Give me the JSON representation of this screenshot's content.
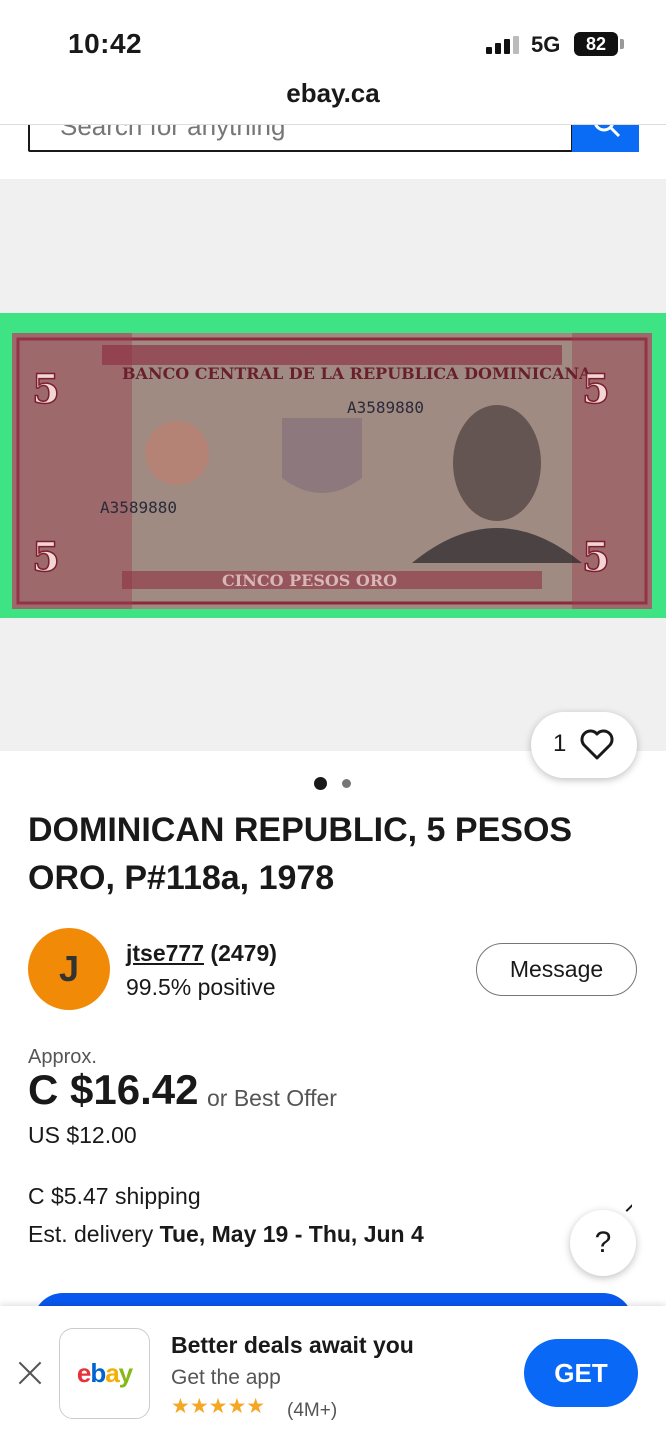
{
  "status_bar": {
    "time": "10:42",
    "network": "5G",
    "battery": "82"
  },
  "browser": {
    "url": "ebay.ca"
  },
  "search": {
    "placeholder": "Search for anything"
  },
  "gallery": {
    "image_alt": "Dominican Republic 5 Pesos Oro banknote",
    "watch_count": "1",
    "page_count": 2,
    "current_page": 1
  },
  "listing": {
    "title": "DOMINICAN REPUBLIC, 5 PESOS ORO, P#118a, 1978"
  },
  "seller": {
    "initial": "J",
    "name": "jtse777",
    "feedback_count": "(2479)",
    "positive": "99.5% positive",
    "message_label": "Message"
  },
  "pricing": {
    "approx_label": "Approx.",
    "price": "C $16.42",
    "best_offer": "or Best Offer",
    "usd_price": "US $12.00",
    "shipping": "C $5.47 shipping",
    "delivery_label": "Est. delivery",
    "delivery_dates": "Tue, May 19 - Thu, Jun 4"
  },
  "help": {
    "label": "?"
  },
  "app_banner": {
    "app_name": "ebay",
    "title": "Better deals await you",
    "subtitle": "Get the app",
    "stars": "★★★★★",
    "rating_count": "(4M+)",
    "get_label": "GET"
  },
  "colors": {
    "accent_blue": "#0968f6",
    "avatar_orange": "#f18a07",
    "image_background_green": "#3ee383"
  }
}
